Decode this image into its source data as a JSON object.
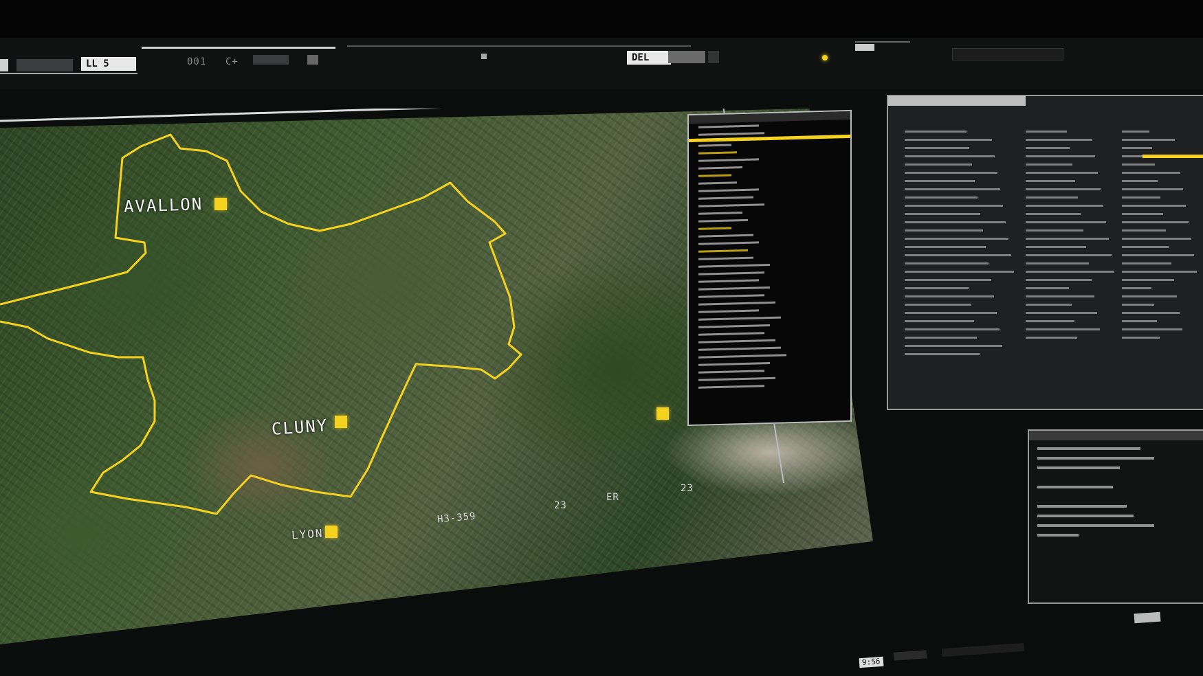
{
  "toolbar": {
    "ll_label": "LL 5",
    "code1": "001",
    "code2": "C+",
    "del_label": "DEL"
  },
  "map": {
    "cities": [
      {
        "name": "AVALLON"
      },
      {
        "name": "CLUNY"
      },
      {
        "name": "LYON"
      }
    ],
    "grid_labels": [
      "H3-359",
      "23",
      "ER",
      "23"
    ],
    "region_color": "#f4d21f"
  },
  "list_panel": {
    "rows": [
      "",
      "",
      "",
      "",
      "",
      "",
      "",
      "",
      "",
      "",
      "",
      "",
      "",
      "",
      "",
      "",
      "",
      "",
      "",
      "",
      "",
      "",
      "",
      "",
      "",
      "",
      "",
      "",
      "",
      "",
      "",
      "",
      "",
      "",
      "",
      ""
    ]
  },
  "bottom_bar": {
    "time": "9:56"
  },
  "accent_color": "#f4d21f"
}
